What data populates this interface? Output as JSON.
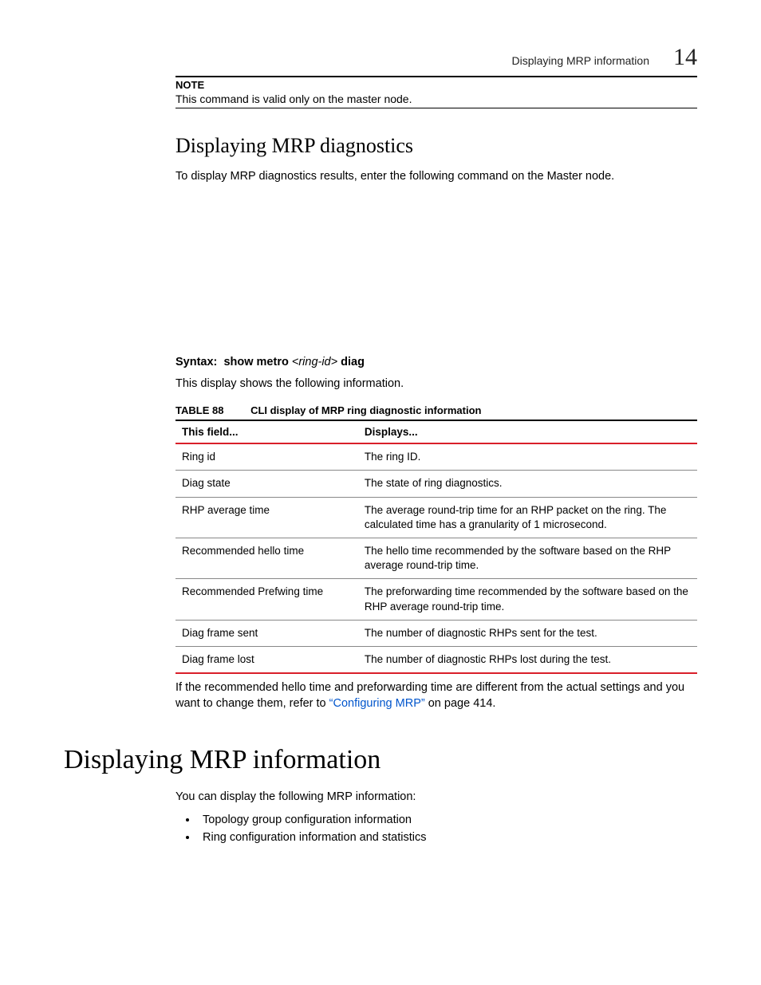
{
  "header": {
    "running_title": "Displaying MRP information",
    "chapter_number": "14"
  },
  "note": {
    "label": "NOTE",
    "text": "This command is valid only on the master node."
  },
  "sectionA": {
    "heading": "Displaying MRP diagnostics",
    "intro": "To display MRP diagnostics results, enter the following command on the Master node.",
    "syntax_label": "Syntax:",
    "syntax_pre": "show metro",
    "syntax_var": "<ring-id>",
    "syntax_post": "diag",
    "desc": "This display shows the following information.",
    "tablecap_label": "TABLE 88",
    "tablecap_title": "CLI display of MRP ring diagnostic information",
    "th_field": "This field...",
    "th_displays": "Displays...",
    "rows": {
      "r0": {
        "field": "Ring id",
        "disp": "The ring ID."
      },
      "r1": {
        "field": "Diag state",
        "disp": "The state of ring diagnostics."
      },
      "r2": {
        "field": "RHP average time",
        "disp": "The average round-trip time for an RHP packet on the ring.  The calculated time has a granularity of 1 microsecond."
      },
      "r3": {
        "field": "Recommended hello time",
        "disp": "The hello time recommended by the software based on the RHP average round-trip time."
      },
      "r4": {
        "field": "Recommended Prefwing time",
        "disp": "The preforwarding time recommended by the software based on the RHP average round-trip time."
      },
      "r5": {
        "field": "Diag frame sent",
        "disp": "The number of diagnostic RHPs sent for the test."
      },
      "r6": {
        "field": "Diag frame lost",
        "disp": "The number of diagnostic RHPs lost during the test."
      }
    },
    "after_table_pre": "If the recommended hello time and preforwarding time are different from the actual settings and you want to change them, refer to ",
    "after_table_link": "“Configuring MRP”",
    "after_table_post": " on page 414."
  },
  "sectionB": {
    "heading": "Displaying MRP information",
    "intro": "You can display the following MRP information:",
    "bullets": {
      "b0": "Topology group configuration information",
      "b1": "Ring configuration information and statistics"
    }
  }
}
